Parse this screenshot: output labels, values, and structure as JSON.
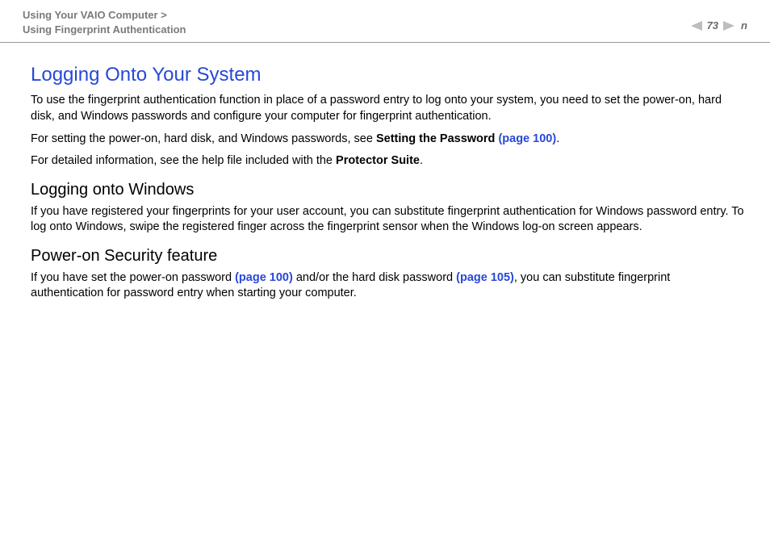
{
  "header": {
    "breadcrumb_line1": "Using Your VAIO Computer >",
    "breadcrumb_line2": "Using Fingerprint Authentication",
    "page_number": "73",
    "letter": "n"
  },
  "main": {
    "title": "Logging Onto Your System",
    "para1": "To use the fingerprint authentication function in place of a password entry to log onto your system, you need to set the power-on, hard disk, and Windows passwords and configure your computer for fingerprint authentication.",
    "para2_pre": "For setting the power-on, hard disk, and Windows passwords, see ",
    "para2_bold": "Setting the Password ",
    "para2_link": "(page 100)",
    "para2_post": ".",
    "para3_pre": "For detailed information, see the help file included with the ",
    "para3_bold": "Protector Suite",
    "para3_post": ".",
    "sub1_title": "Logging onto Windows",
    "sub1_para": "If you have registered your fingerprints for your user account, you can substitute fingerprint authentication for Windows password entry. To log onto Windows, swipe the registered finger across the fingerprint sensor when the Windows log-on screen appears.",
    "sub2_title": "Power-on Security feature",
    "sub2_para_pre": "If you have set the power-on password ",
    "sub2_link1": "(page 100)",
    "sub2_para_mid": " and/or the hard disk password ",
    "sub2_link2": "(page 105)",
    "sub2_para_post": ", you can substitute fingerprint authentication for password entry when starting your computer."
  }
}
